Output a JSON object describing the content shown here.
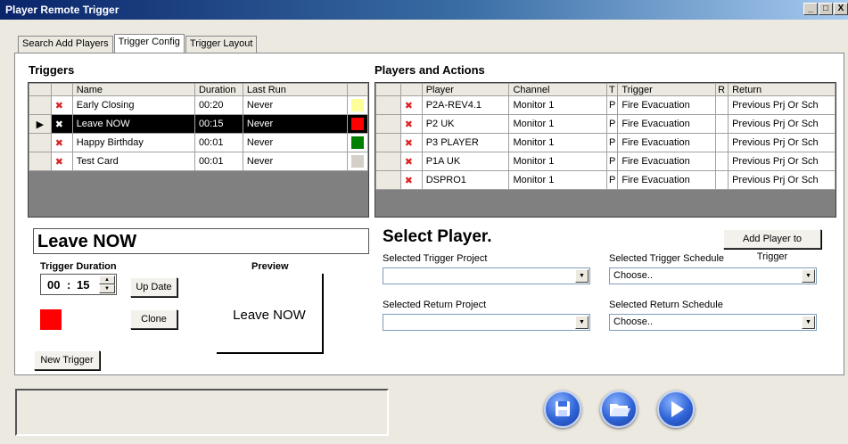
{
  "window": {
    "title": "Player Remote Trigger",
    "min": "_",
    "max": "□",
    "close": "X"
  },
  "tabs": [
    "Search Add Players",
    "Trigger Config",
    "Trigger Layout"
  ],
  "triggers": {
    "title": "Triggers",
    "columns": [
      "Name",
      "Duration",
      "Last Run"
    ],
    "rows": [
      {
        "name": "Early Closing",
        "duration": "00:20",
        "last_run": "Never",
        "color": "#ffff99"
      },
      {
        "name": "Leave NOW",
        "duration": "00:15",
        "last_run": "Never",
        "color": "#ff0000"
      },
      {
        "name": "Happy Birthday",
        "duration": "00:01",
        "last_run": "Never",
        "color": "#008000"
      },
      {
        "name": "Test Card",
        "duration": "00:01",
        "last_run": "Never",
        "color": "#d4d0c8"
      }
    ]
  },
  "players": {
    "title": "Players and Actions",
    "columns": [
      "Player",
      "Channel",
      "T",
      "Trigger",
      "R",
      "Return"
    ],
    "rows": [
      {
        "player": "P2A-REV4.1",
        "channel": "Monitor 1",
        "t": "P",
        "trigger": "Fire Evacuation",
        "r": "",
        "return": "Previous Prj Or Sch"
      },
      {
        "player": "P2 UK",
        "channel": "Monitor 1",
        "t": "P",
        "trigger": "Fire Evacuation",
        "r": "",
        "return": "Previous Prj Or Sch"
      },
      {
        "player": "P3 PLAYER",
        "channel": "Monitor 1",
        "t": "P",
        "trigger": "Fire Evacuation",
        "r": "",
        "return": "Previous Prj Or Sch"
      },
      {
        "player": "P1A UK",
        "channel": "Monitor 1",
        "t": "P",
        "trigger": "Fire Evacuation",
        "r": "",
        "return": "Previous Prj Or Sch"
      },
      {
        "player": "DSPRO1",
        "channel": "Monitor 1",
        "t": "P",
        "trigger": "Fire Evacuation",
        "r": "",
        "return": "Previous Prj Or Sch"
      }
    ]
  },
  "editor": {
    "name_value": "Leave NOW",
    "duration_label": "Trigger Duration",
    "duration_min": "00",
    "duration_sep": ":",
    "duration_sec": "15",
    "color": "#ff0000",
    "update_button": "Up Date",
    "clone_button": "Clone",
    "new_trigger_button": "New Trigger",
    "preview_label": "Preview",
    "preview_text": "Leave NOW"
  },
  "player_select": {
    "heading": "Select Player.",
    "add_button": "Add Player to Trigger",
    "trigger_project_label": "Selected Trigger Project",
    "trigger_project_value": "",
    "trigger_schedule_label": "Selected Trigger Schedule",
    "trigger_schedule_value": "Choose..",
    "return_project_label": "Selected Return Project",
    "return_project_value": "",
    "return_schedule_label": "Selected Return Schedule",
    "return_schedule_value": "Choose.."
  },
  "footer": {
    "status_text": "",
    "buttons": [
      "save-icon",
      "open-folder-icon",
      "play-icon"
    ]
  }
}
